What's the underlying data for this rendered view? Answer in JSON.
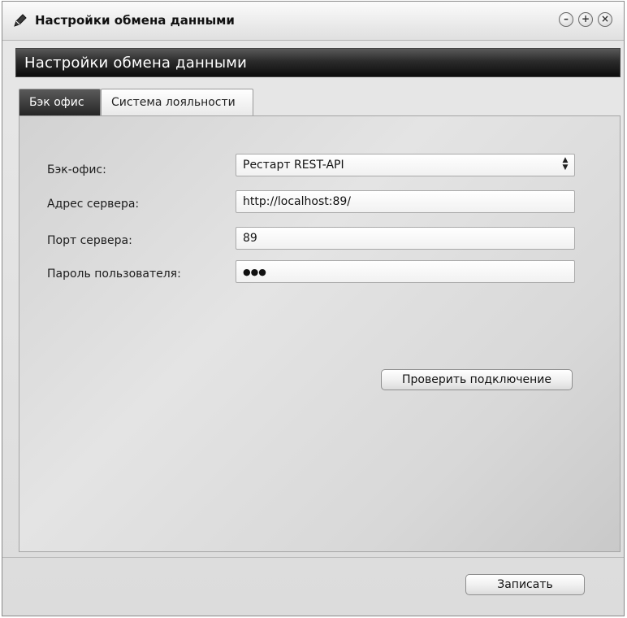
{
  "window": {
    "title": "Настройки обмена данными",
    "header": "Настройки обмена данными",
    "controls": {
      "minimize": "–",
      "maximize": "+",
      "close": "×"
    }
  },
  "tabs": [
    {
      "label": "Бэк офис",
      "active": true
    },
    {
      "label": "Система лояльности",
      "active": false
    }
  ],
  "form": {
    "backoffice": {
      "label": "Бэк-офис:",
      "value": "Рестарт REST-API"
    },
    "server_address": {
      "label": "Адрес сервера:",
      "value": "http://localhost:89/"
    },
    "server_port": {
      "label": "Порт сервера:",
      "value": "89"
    },
    "user_password": {
      "label": "Пароль пользователя:",
      "value": "●●●"
    }
  },
  "buttons": {
    "test_connection": "Проверить подключение",
    "save": "Записать"
  },
  "colors": {
    "header_bg": "#1a1a1a",
    "active_tab_bg": "#333333",
    "panel_bg": "#dcdcdc"
  }
}
